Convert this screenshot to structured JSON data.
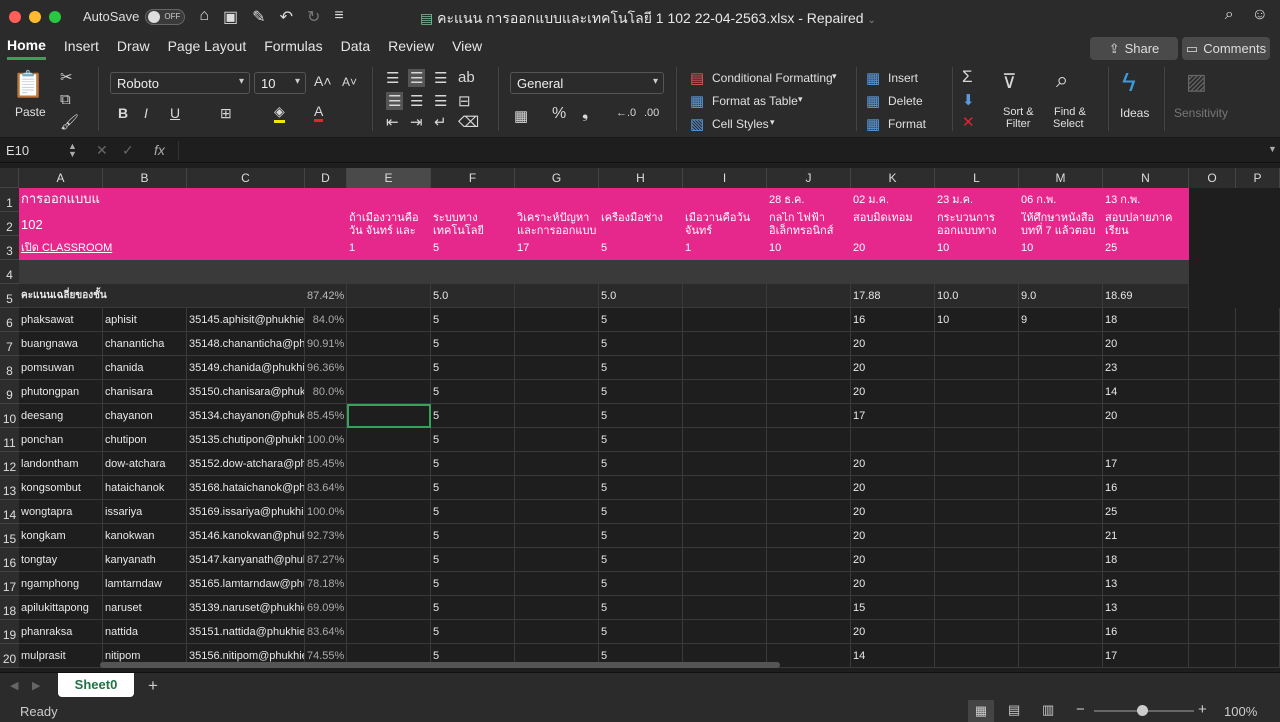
{
  "titlebar": {
    "autosave_label": "AutoSave",
    "autosave_state": "OFF",
    "doc_title": "คะแนน การออกแบบและเทคโนโลยี 1 102 22-04-2563.xlsx  -  Repaired"
  },
  "tabs": [
    "Home",
    "Insert",
    "Draw",
    "Page Layout",
    "Formulas",
    "Data",
    "Review",
    "View"
  ],
  "share_label": "Share",
  "comments_label": "Comments",
  "ribbon": {
    "paste": "Paste",
    "font_name": "Roboto",
    "font_size": "10",
    "number_format": "General",
    "conditional_formatting": "Conditional Formatting",
    "format_as_table": "Format as Table",
    "cell_styles": "Cell Styles",
    "insert": "Insert",
    "delete": "Delete",
    "format": "Format",
    "sort_filter_1": "Sort &",
    "sort_filter_2": "Filter",
    "find_select_1": "Find &",
    "find_select_2": "Select",
    "ideas": "Ideas",
    "sensitivity": "Sensitivity"
  },
  "formula": {
    "namebox": "E10",
    "fx": "fx"
  },
  "columns": [
    "A",
    "B",
    "C",
    "D",
    "E",
    "F",
    "G",
    "H",
    "I",
    "J",
    "K",
    "L",
    "M",
    "N",
    "O",
    "P"
  ],
  "header_rows": {
    "a1": "การออกแบบแ",
    "a2": "102",
    "a3": "เปิด CLASSROOM",
    "j1": "28 ธ.ค.",
    "k1": "02 ม.ค.",
    "l1": "23 ม.ค.",
    "m1": "06 ก.พ.",
    "n1": "13 ก.พ.",
    "e2": "ถ้าเมืองวานคือวัน จันทร์ และวันพรีน",
    "f2": "ระบบทาง เทคโนโลยี",
    "g2": "วิเคราะห์ปัญหา และการออกแบบ",
    "h2": "เครื่องมือช่าง",
    "i2": "เมื่อวานคือวัน จันทร์",
    "j2": "กลไก ไฟฟ้า อิเล็กทรอนิกส์",
    "k2": "สอบมิดเทอม",
    "l2": "กระบวนการ ออกแบบทาง",
    "m2": "ให้ศึกษาหนังสือ บทที่ 7 แล้วตอบ",
    "n2": "สอบปลายภาคเรียน",
    "e3": "1",
    "f3": "5",
    "g3": "17",
    "h3": "5",
    "i3": "1",
    "j3": "10",
    "k3": "20",
    "l3": "10",
    "m3": "10",
    "n3": "25"
  },
  "avg_row": {
    "label": "คะแนนเฉลี่ยของชั้น",
    "d": "87.42%",
    "f": "5.0",
    "h": "5.0",
    "k": "17.88",
    "l": "10.0",
    "m": "9.0",
    "n": "18.69"
  },
  "students": [
    {
      "row": "6",
      "a": "phaksawat",
      "b": "aphisit",
      "c": "35145.aphisit@phukhieo",
      "d": "84.0%",
      "f": "5",
      "h": "5",
      "k": "16",
      "l": "10",
      "m": "9",
      "n": "18"
    },
    {
      "row": "7",
      "a": "buangnawa",
      "b": "chananticha",
      "c": "35148.chananticha@phu",
      "d": "90.91%",
      "f": "5",
      "h": "5",
      "k": "20",
      "l": "",
      "m": "",
      "n": "20"
    },
    {
      "row": "8",
      "a": "pomsuwan",
      "b": "chanida",
      "c": "35149.chanida@phukhie",
      "d": "96.36%",
      "f": "5",
      "h": "5",
      "k": "20",
      "l": "",
      "m": "",
      "n": "23"
    },
    {
      "row": "9",
      "a": "phutongpan",
      "b": "chanisara",
      "c": "35150.chanisara@phukh",
      "d": "80.0%",
      "f": "5",
      "h": "5",
      "k": "20",
      "l": "",
      "m": "",
      "n": "14"
    },
    {
      "row": "10",
      "a": "deesang",
      "b": "chayanon",
      "c": "35134.chayanon@phukh",
      "d": "85.45%",
      "f": "5",
      "h": "5",
      "k": "17",
      "l": "",
      "m": "",
      "n": "20"
    },
    {
      "row": "11",
      "a": "ponchan",
      "b": "chutipon",
      "c": "35135.chutipon@phukhi",
      "d": "100.0%",
      "f": "5",
      "h": "5",
      "k": "",
      "l": "",
      "m": "",
      "n": ""
    },
    {
      "row": "12",
      "a": "landontham",
      "b": "dow-atchara",
      "c": "35152.dow-atchara@phu",
      "d": "85.45%",
      "f": "5",
      "h": "5",
      "k": "20",
      "l": "",
      "m": "",
      "n": "17"
    },
    {
      "row": "13",
      "a": "kongsombut",
      "b": "hataichanok",
      "c": "35168.hataichanok@phu",
      "d": "83.64%",
      "f": "5",
      "h": "5",
      "k": "20",
      "l": "",
      "m": "",
      "n": "16"
    },
    {
      "row": "14",
      "a": "wongtapra",
      "b": "issariya",
      "c": "35169.issariya@phukhie",
      "d": "100.0%",
      "f": "5",
      "h": "5",
      "k": "20",
      "l": "",
      "m": "",
      "n": "25"
    },
    {
      "row": "15",
      "a": "kongkam",
      "b": "kanokwan",
      "c": "35146.kanokwan@phuk",
      "d": "92.73%",
      "f": "5",
      "h": "5",
      "k": "20",
      "l": "",
      "m": "",
      "n": "21"
    },
    {
      "row": "16",
      "a": "tongtay",
      "b": "kanyanath",
      "c": "35147.kanyanath@phuk",
      "d": "87.27%",
      "f": "5",
      "h": "5",
      "k": "20",
      "l": "",
      "m": "",
      "n": "18"
    },
    {
      "row": "17",
      "a": "ngamphong",
      "b": "lamtarndaw",
      "c": "35165.lamtarndaw@phu",
      "d": "78.18%",
      "f": "5",
      "h": "5",
      "k": "20",
      "l": "",
      "m": "",
      "n": "13"
    },
    {
      "row": "18",
      "a": "apilukittapong",
      "b": "naruset",
      "c": "35139.naruset@phukhie",
      "d": "69.09%",
      "f": "5",
      "h": "5",
      "k": "15",
      "l": "",
      "m": "",
      "n": "13"
    },
    {
      "row": "19",
      "a": "phanraksa",
      "b": "nattida",
      "c": "35151.nattida@phukhieo",
      "d": "83.64%",
      "f": "5",
      "h": "5",
      "k": "20",
      "l": "",
      "m": "",
      "n": "16"
    },
    {
      "row": "20",
      "a": "mulprasit",
      "b": "nitipom",
      "c": "35156.nitipom@phukhie",
      "d": "74.55%",
      "f": "5",
      "h": "5",
      "k": "14",
      "l": "",
      "m": "",
      "n": "17"
    }
  ],
  "sheet_tab": "Sheet0",
  "status": {
    "ready": "Ready",
    "zoom": "100%"
  },
  "colors": {
    "accent_pink": "#e6278c",
    "accent_green": "#37a35a"
  }
}
